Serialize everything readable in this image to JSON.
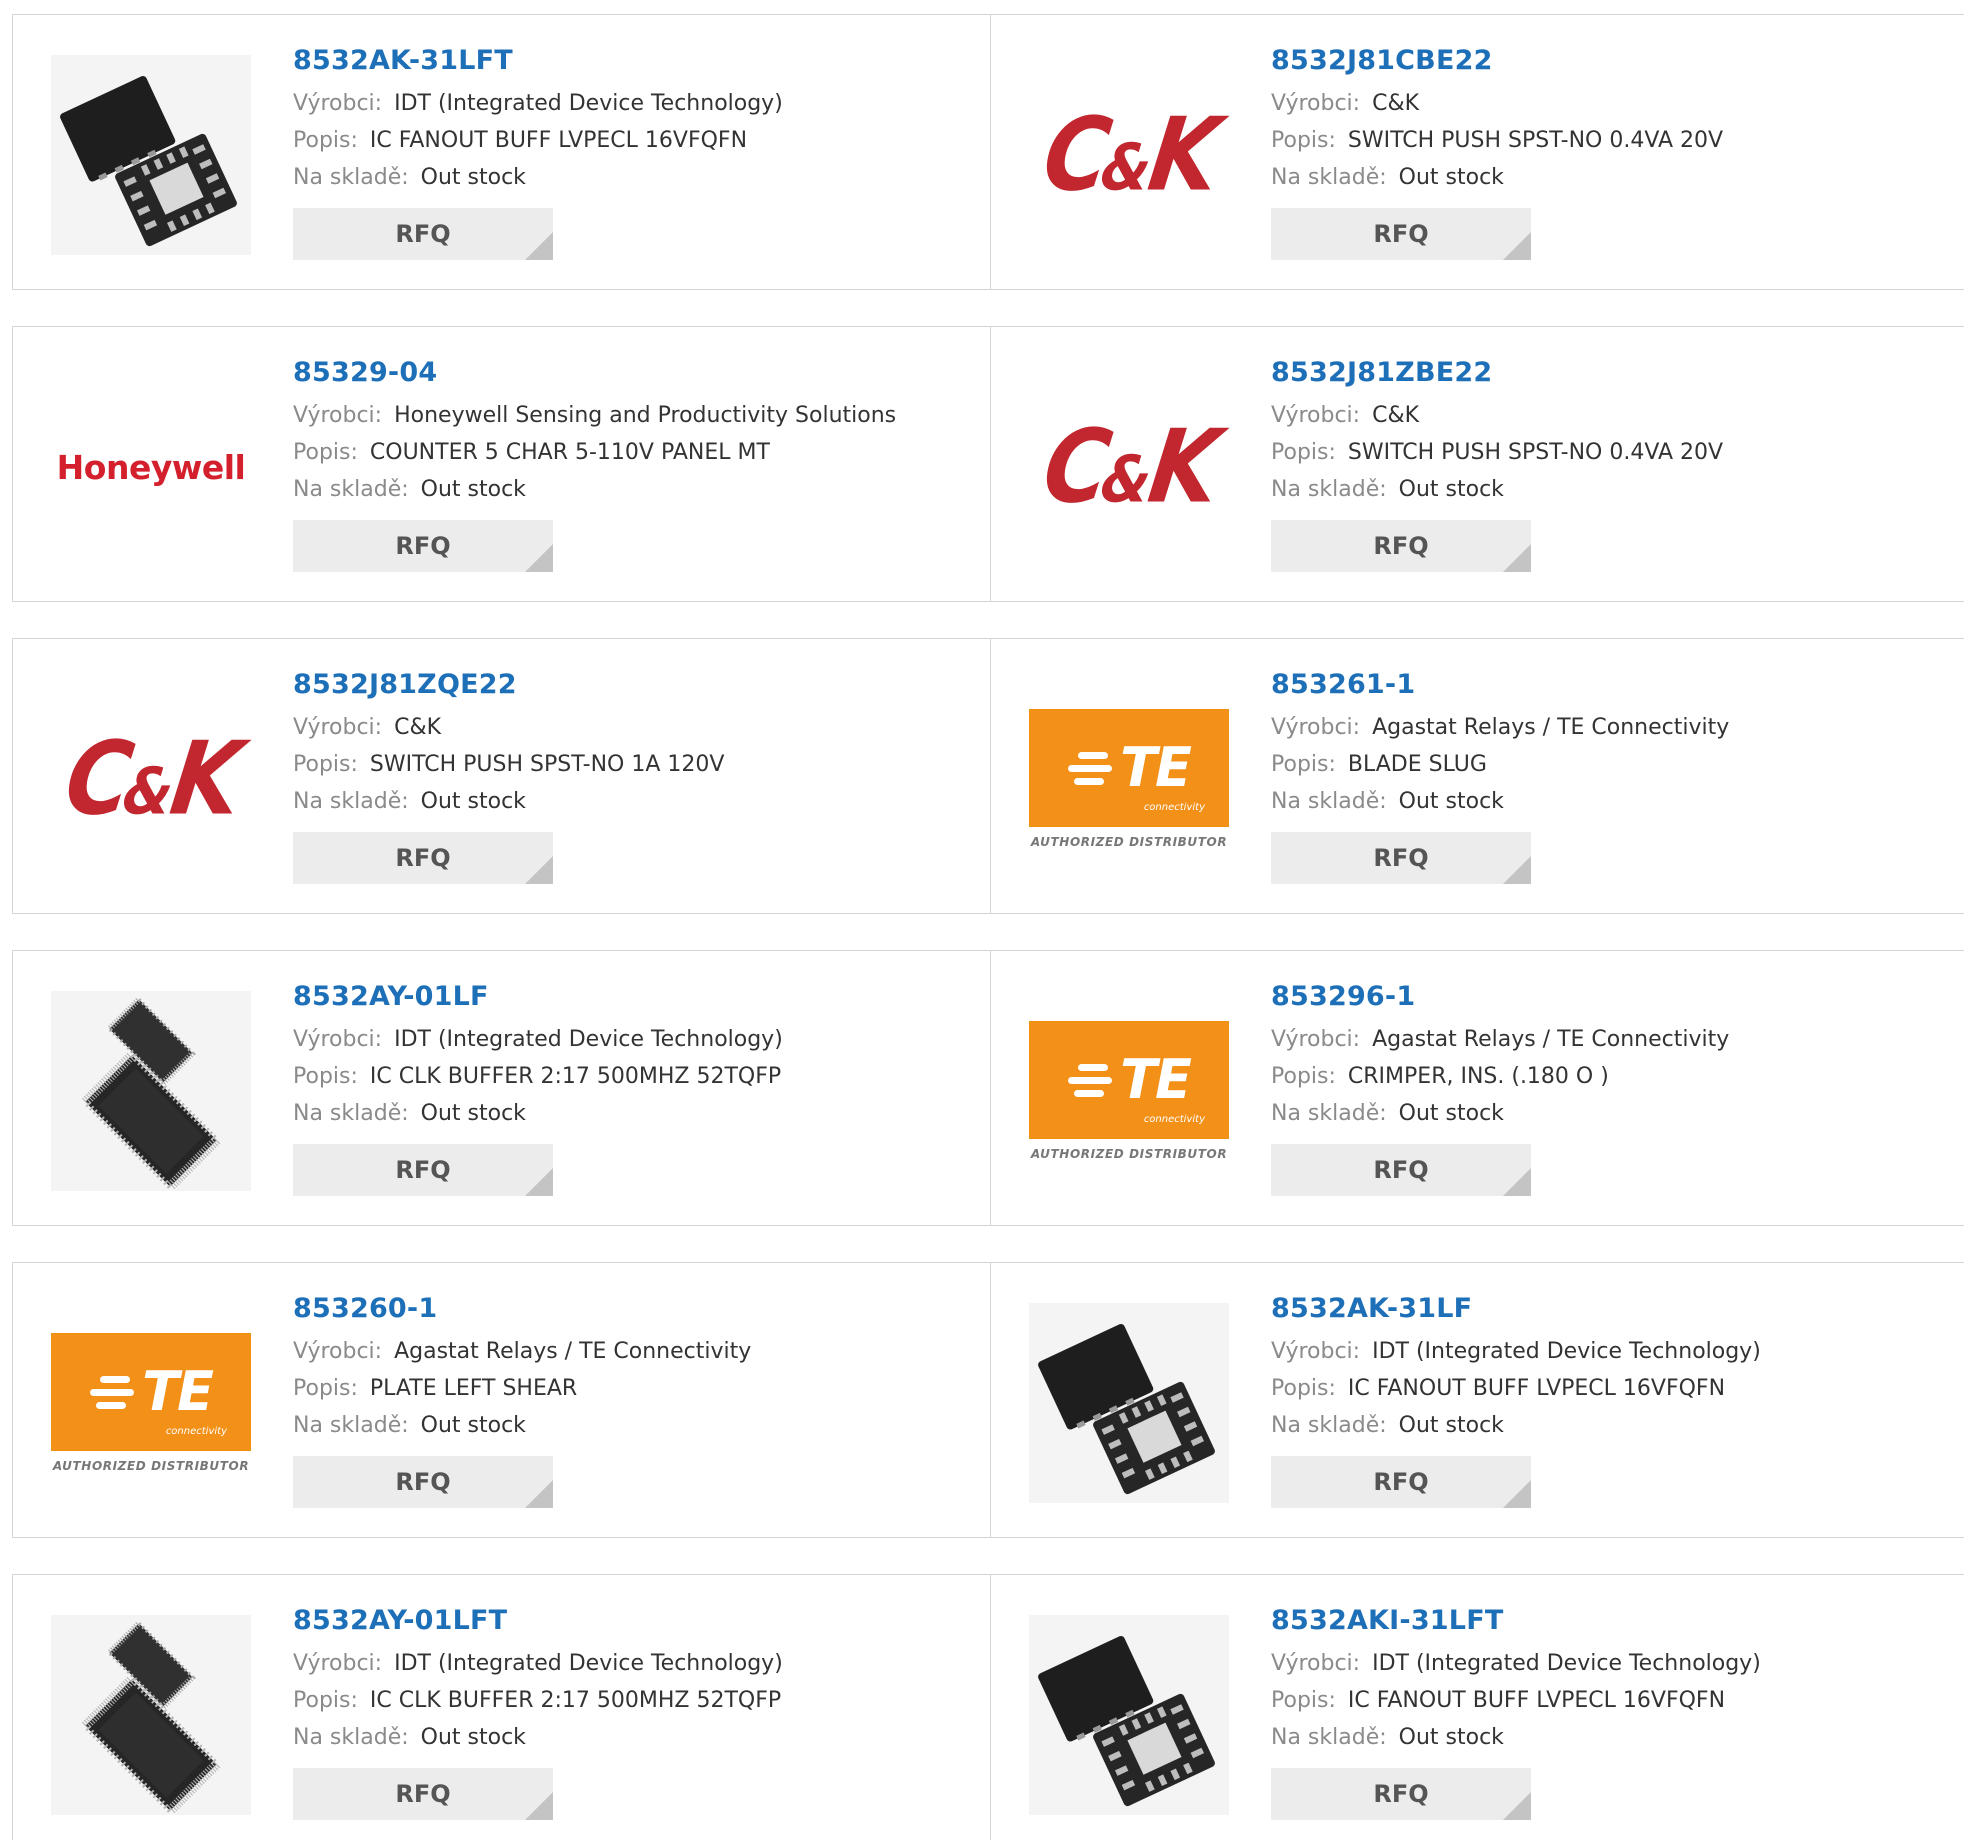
{
  "labels": {
    "manufacturer": "Výrobci:",
    "description": "Popis:",
    "stock": "Na skladě:",
    "rfq": "RFQ"
  },
  "logos": {
    "ck_brand": "C&K",
    "honeywell": "Honeywell",
    "te_brand": "TE",
    "te_sub": "connectivity",
    "te_authorized": "AUTHORIZED DISTRIBUTOR"
  },
  "products": [
    {
      "part": "8532AK-31LFT",
      "manufacturer": "IDT (Integrated Device Technology)",
      "description": "IC FANOUT BUFF LVPECL 16VFQFN",
      "stock": "Out stock",
      "image": "qfn-chip-icon"
    },
    {
      "part": "8532J81CBE22",
      "manufacturer": "C&K",
      "description": "SWITCH PUSH SPST-NO 0.4VA 20V",
      "stock": "Out stock",
      "image": "ck-logo"
    },
    {
      "part": "85329-04",
      "manufacturer": "Honeywell Sensing and Productivity Solutions",
      "description": "COUNTER 5 CHAR 5-110V PANEL MT",
      "stock": "Out stock",
      "image": "honeywell-logo"
    },
    {
      "part": "8532J81ZBE22",
      "manufacturer": "C&K",
      "description": "SWITCH PUSH SPST-NO 0.4VA 20V",
      "stock": "Out stock",
      "image": "ck-logo"
    },
    {
      "part": "8532J81ZQE22",
      "manufacturer": "C&K",
      "description": "SWITCH PUSH SPST-NO 1A 120V",
      "stock": "Out stock",
      "image": "ck-logo"
    },
    {
      "part": "853261-1",
      "manufacturer": "Agastat Relays / TE Connectivity",
      "description": "BLADE SLUG",
      "stock": "Out stock",
      "image": "te-logo"
    },
    {
      "part": "8532AY-01LF",
      "manufacturer": "IDT (Integrated Device Technology)",
      "description": "IC CLK BUFFER 2:17 500MHZ 52TQFP",
      "stock": "Out stock",
      "image": "tqfp-chip-icon"
    },
    {
      "part": "853296-1",
      "manufacturer": "Agastat Relays / TE Connectivity",
      "description": "CRIMPER, INS. (.180 O )",
      "stock": "Out stock",
      "image": "te-logo"
    },
    {
      "part": "853260-1",
      "manufacturer": "Agastat Relays / TE Connectivity",
      "description": "PLATE LEFT SHEAR",
      "stock": "Out stock",
      "image": "te-logo"
    },
    {
      "part": "8532AK-31LF",
      "manufacturer": "IDT (Integrated Device Technology)",
      "description": "IC FANOUT BUFF LVPECL 16VFQFN",
      "stock": "Out stock",
      "image": "qfn-chip-icon"
    },
    {
      "part": "8532AY-01LFT",
      "manufacturer": "IDT (Integrated Device Technology)",
      "description": "IC CLK BUFFER 2:17 500MHZ 52TQFP",
      "stock": "Out stock",
      "image": "tqfp-chip-icon"
    },
    {
      "part": "8532AKI-31LFT",
      "manufacturer": "IDT (Integrated Device Technology)",
      "description": "IC FANOUT BUFF LVPECL 16VFQFN",
      "stock": "Out stock",
      "image": "qfn-chip-icon"
    }
  ],
  "colors": {
    "link": "#1d6fb8",
    "ck_red": "#c2262e",
    "honeywell_red": "#d4202c",
    "te_orange": "#f29018",
    "button_bg": "#ececec"
  }
}
